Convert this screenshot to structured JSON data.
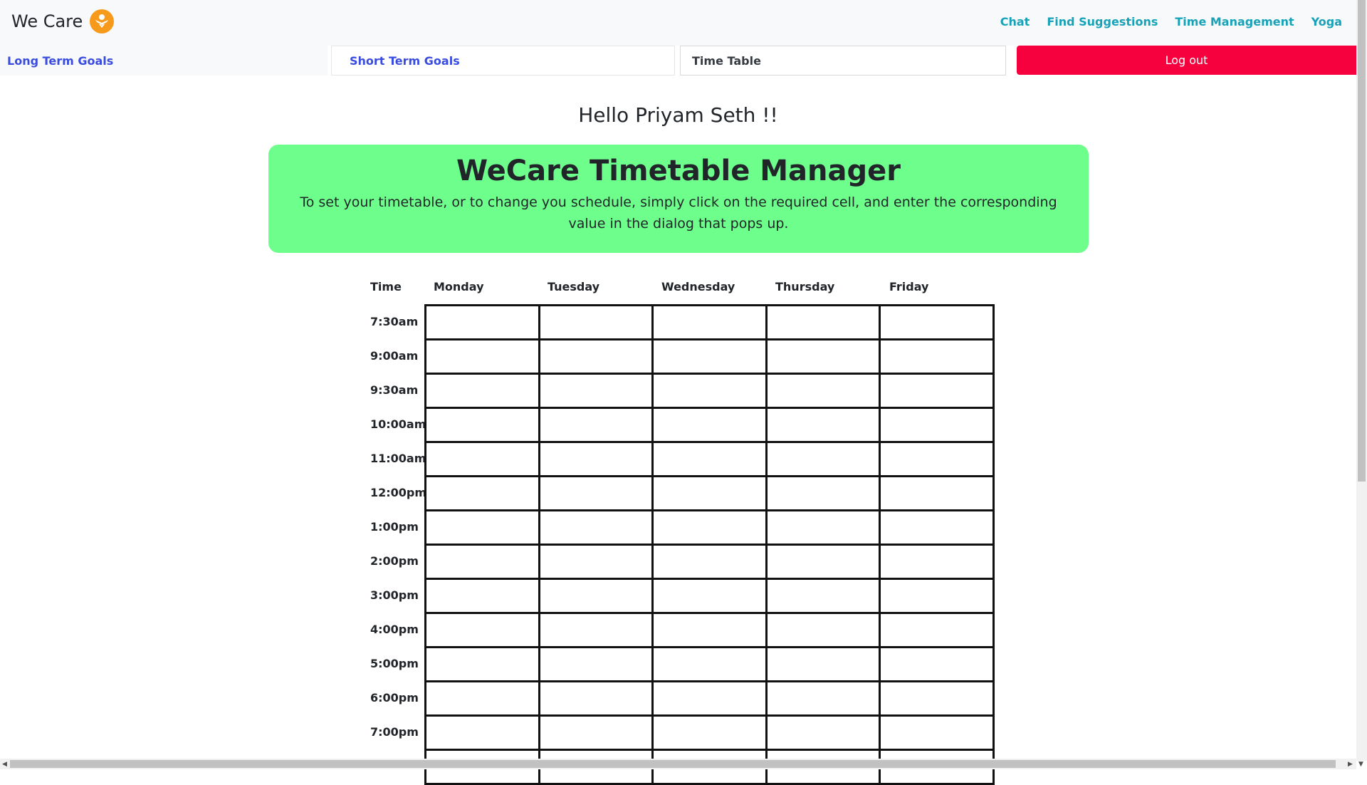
{
  "brand": {
    "name": "We Care",
    "icon": "we-care-logo-icon"
  },
  "nav": [
    "Chat",
    "Find Suggestions",
    "Time Management",
    "Yoga"
  ],
  "tabs": {
    "long_term": "Long Term Goals",
    "short_term": "Short Term Goals",
    "timetable": "Time Table",
    "logout": "Log out"
  },
  "greeting": "Hello Priyam Seth !!",
  "banner": {
    "title": "WeCare Timetable Manager",
    "text": "To set your timetable, or to change you schedule, simply click on the required cell, and enter the corresponding value in the dialog that pops up."
  },
  "table": {
    "time_header": "Time",
    "days": [
      "Monday",
      "Tuesday",
      "Wednesday",
      "Thursday",
      "Friday"
    ],
    "times": [
      "7:30am",
      "9:00am",
      "9:30am",
      "10:00am",
      "11:00am",
      "12:00pm",
      "1:00pm",
      "2:00pm",
      "3:00pm",
      "4:00pm",
      "5:00pm",
      "6:00pm",
      "7:00pm"
    ]
  },
  "colors": {
    "banner": "#6dfe8c",
    "logout": "#f6003e",
    "nav_link": "#17a2b8",
    "tab_link": "#3a4ce0",
    "brand_icon": "#f79a1c"
  }
}
